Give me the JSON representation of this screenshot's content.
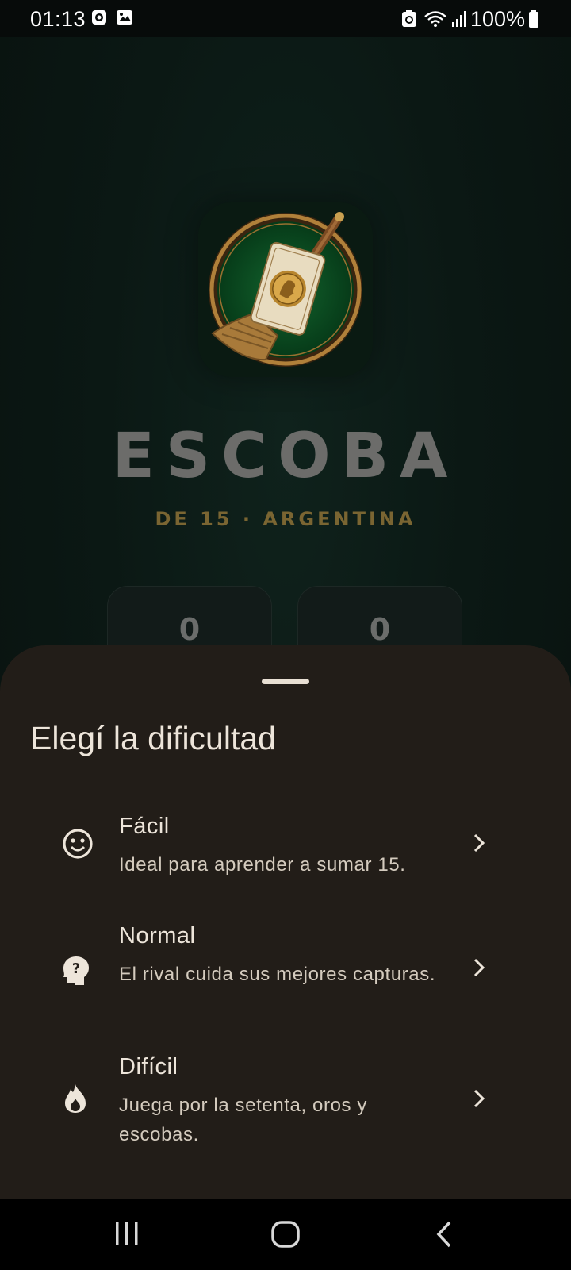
{
  "status_bar": {
    "time": "01:13",
    "battery": "100%",
    "icons": [
      "pocket-casts-icon",
      "gallery-icon",
      "recycle-icon",
      "wifi-icon",
      "signal-icon",
      "battery-icon"
    ]
  },
  "app": {
    "logo_icon": "escoba-card-broom-logo",
    "title": "ESCOBA",
    "subtitle": "DE 15 · ARGENTINA",
    "scores": [
      "0",
      "0"
    ]
  },
  "sheet": {
    "title": "Elegí la dificultad",
    "options": [
      {
        "icon": "smiley-icon",
        "title": "Fácil",
        "description": "Ideal para aprender a sumar 15."
      },
      {
        "icon": "head-question-icon",
        "title": "Normal",
        "description": "El rival cuida sus mejores capturas."
      },
      {
        "icon": "fire-icon",
        "title": "Difícil",
        "description": "Juega por la setenta, oros y escobas."
      }
    ]
  },
  "nav_bar": {
    "buttons": [
      "recents-icon",
      "home-icon",
      "back-icon"
    ]
  },
  "colors": {
    "background": "#0c1512",
    "sheet": "#221d18",
    "title": "#6c6c6a",
    "subtitle_gold": "#7a6532",
    "text": "#ede5da"
  }
}
